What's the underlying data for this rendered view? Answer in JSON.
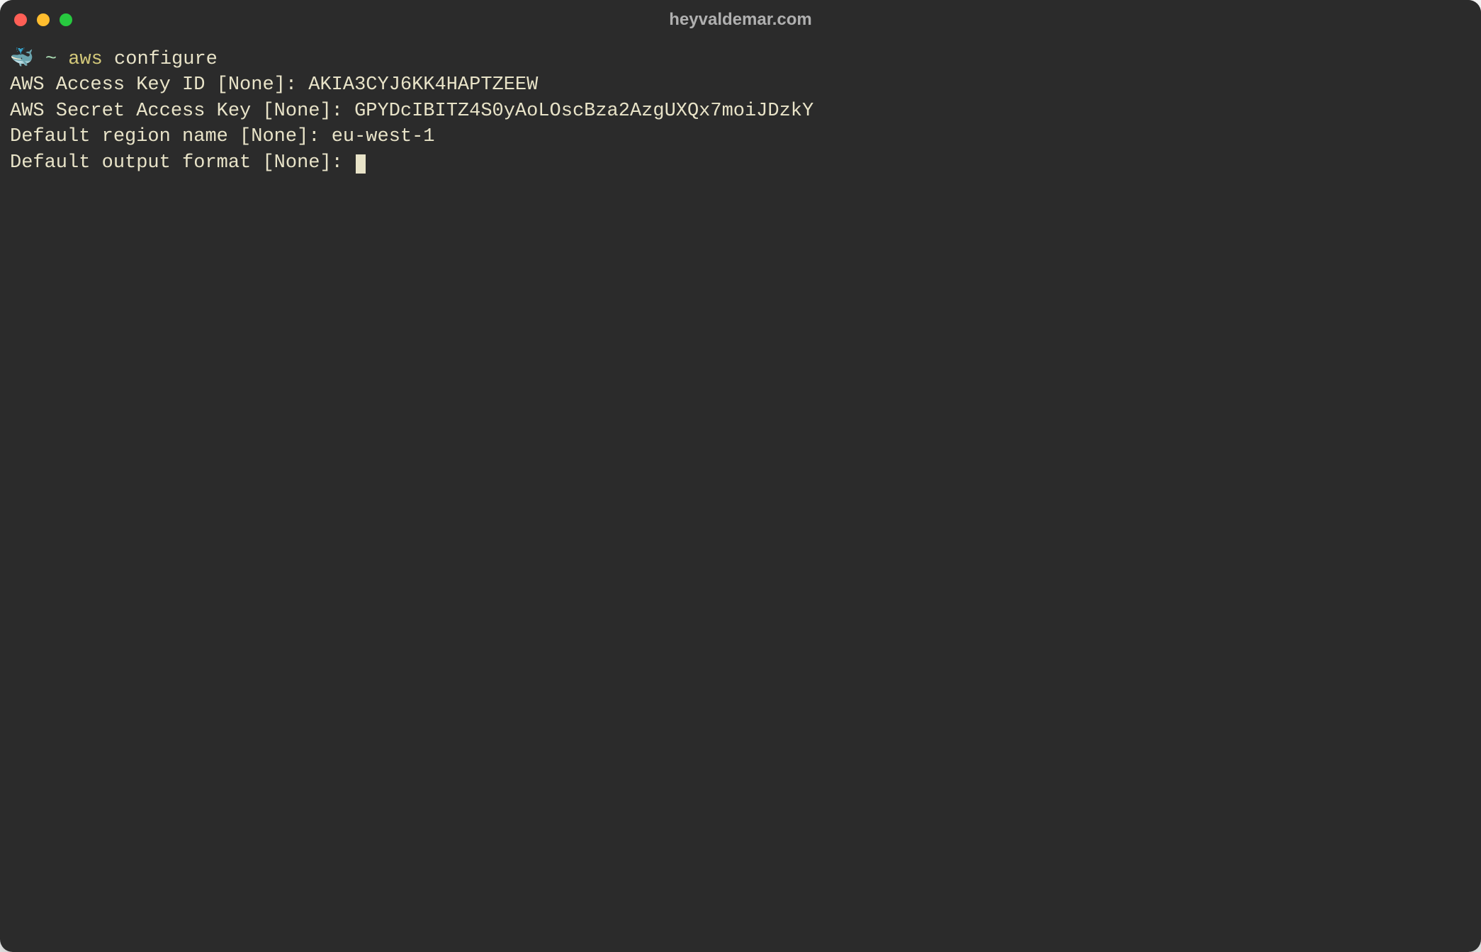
{
  "window": {
    "title": "heyvaldemar.com"
  },
  "prompt": {
    "icon": "🐳",
    "tilde": "~",
    "command_part1": "aws",
    "command_part2": "configure"
  },
  "lines": {
    "line1_label": "AWS Access Key ID [None]: ",
    "line1_value": "AKIA3CYJ6KK4HAPTZEEW",
    "line2_label": "AWS Secret Access Key [None]: ",
    "line2_value": "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",
    "line3_label": "Default region name [None]: ",
    "line3_value": "eu-west-1",
    "line4_label": "Default output format [None]: ",
    "line4_value": ""
  }
}
